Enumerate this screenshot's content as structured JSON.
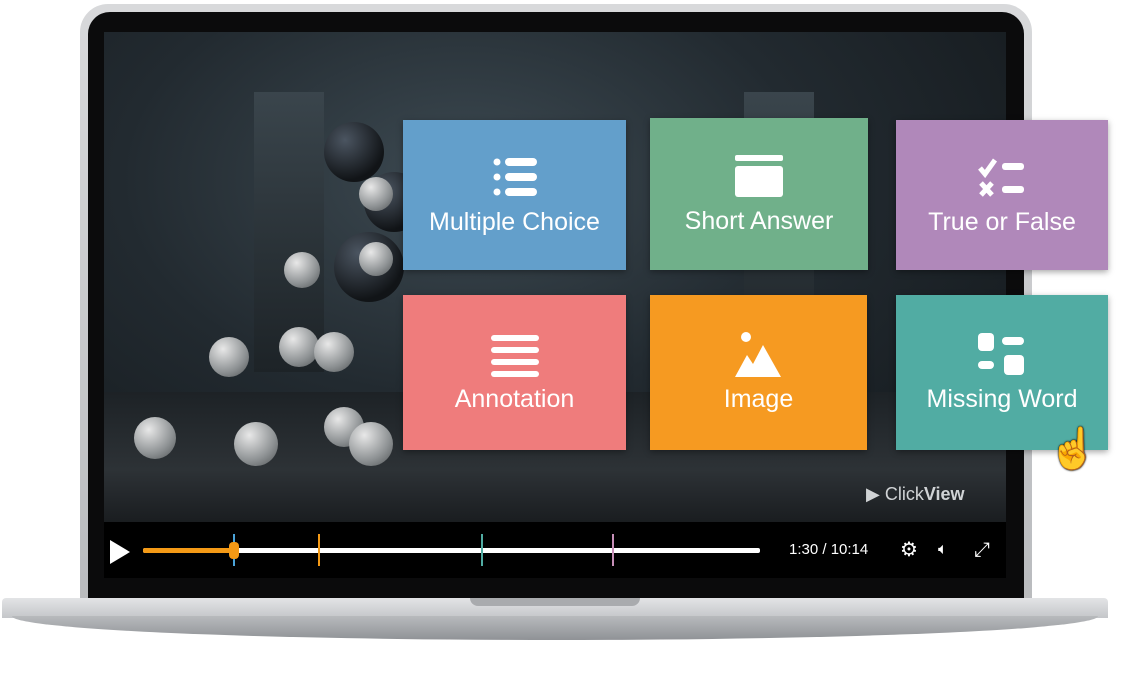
{
  "tiles": [
    {
      "label": "Multiple Choice",
      "icon": "list-icon",
      "color": "#639fcb"
    },
    {
      "label": "Short Answer",
      "icon": "text-box-icon",
      "color": "#70b08a"
    },
    {
      "label": "True or False",
      "icon": "check-cross-icon",
      "color": "#b088ba"
    },
    {
      "label": "Annotation",
      "icon": "lines-icon",
      "color": "#ef7c7c"
    },
    {
      "label": "Image",
      "icon": "image-icon",
      "color": "#f69a21"
    },
    {
      "label": "Missing Word",
      "icon": "missing-word-icon",
      "color": "#51aca3"
    }
  ],
  "player": {
    "time": "1:30 / 10:14",
    "progress_percent": 14.7,
    "markers": [
      {
        "percent": 14.7,
        "color": "#4aa3d8"
      },
      {
        "percent": 28.5,
        "color": "#f49a16"
      },
      {
        "percent": 54.9,
        "color": "#51aca3"
      },
      {
        "percent": 76.1,
        "color": "#c78fb8"
      }
    ],
    "accent": "#f49a16"
  },
  "logo": {
    "prefix": "Click",
    "suffix": "View"
  }
}
